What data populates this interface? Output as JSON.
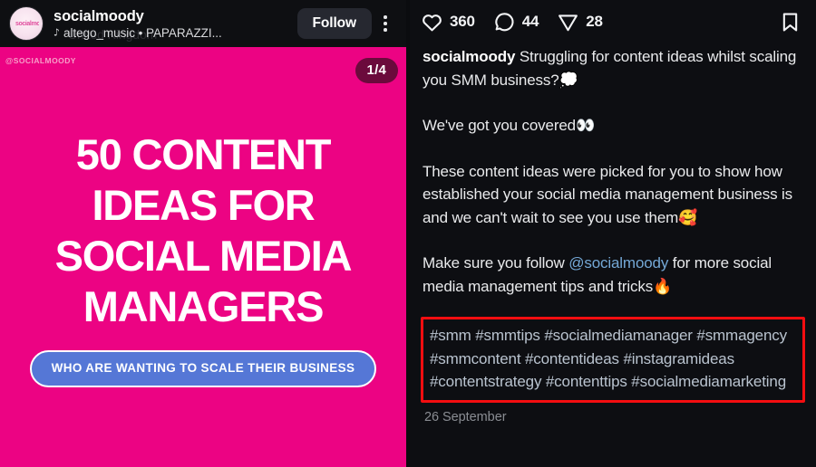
{
  "post": {
    "header": {
      "account_name": "socialmoody",
      "audio_icon": "music-note-icon",
      "audio_text": "altego_music • PAPARAZZI...",
      "ghost_location_text": "United Kingdom",
      "follow_label": "Follow",
      "menu_icon": "kebab-menu-icon",
      "avatar_mark": "socialmoody"
    },
    "slide": {
      "watermark": "@SOCIALMOODY",
      "counter": "1/4",
      "headline_lines": [
        "50 CONTENT",
        "IDEAS FOR",
        "SOCIAL MEDIA",
        "MANAGERS"
      ],
      "cta_label": "WHO ARE WANTING TO SCALE THEIR BUSINESS",
      "background_color": "#ec0383",
      "cta_color": "#5577d6",
      "badge_color": "#6b0a3c"
    },
    "actions": {
      "like": {
        "icon": "heart-icon",
        "count": "360"
      },
      "comment": {
        "icon": "comment-bubble-icon",
        "count": "44"
      },
      "share": {
        "icon": "paper-plane-icon",
        "count": "28"
      },
      "save": {
        "icon": "bookmark-icon"
      }
    },
    "caption": {
      "username": "socialmoody",
      "paragraph1_text": " Struggling for content ideas whilst scaling you SMM business?",
      "paragraph1_emoji": "💭",
      "paragraph2_text": "We've got you covered",
      "paragraph2_emoji": "👀",
      "paragraph3_text": "These content ideas were picked for you to show how established your social media management business is and we can't wait to see you use them",
      "paragraph3_emoji": "🥰",
      "paragraph4_prefix": "Make sure you follow ",
      "paragraph4_mention": "@socialmoody",
      "paragraph4_suffix": " for more social media management tips and tricks",
      "paragraph4_emoji": "🔥",
      "mention_color": "#74a8d6"
    },
    "hashtags": {
      "text": "#smm #smmtips #socialmediamanager #smmagency #smmcontent #contentideas #instagramideas #contentstrategy #contenttips #socialmediamarketing",
      "highlight_color": "#f40d10"
    },
    "timestamp": "26 September"
  }
}
